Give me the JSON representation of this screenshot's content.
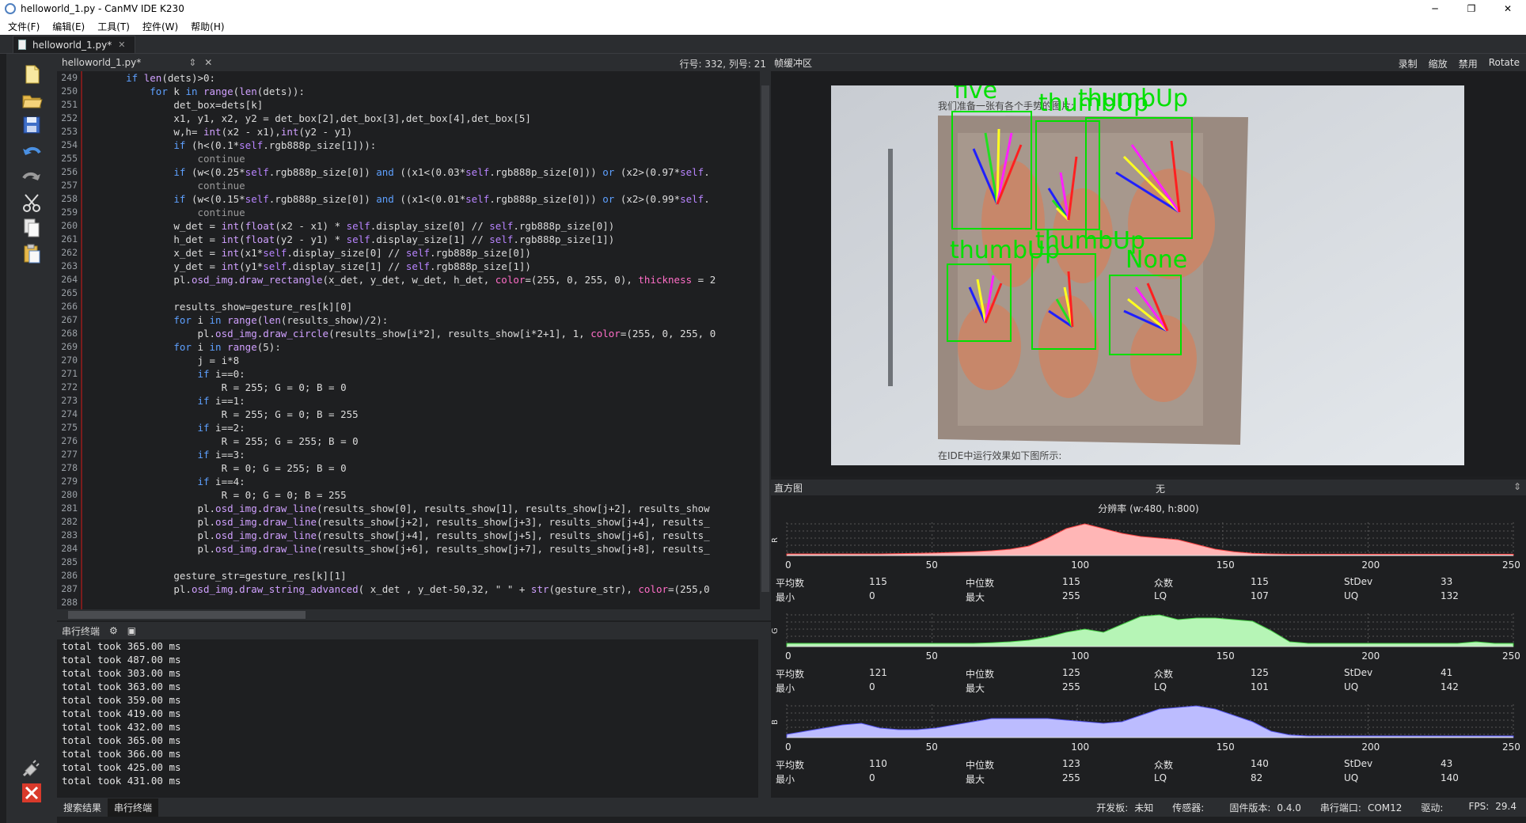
{
  "window": {
    "title": "helloworld_1.py - CanMV IDE K230",
    "controls": {
      "minimize": "─",
      "maximize": "❐",
      "close": "✕"
    }
  },
  "menu": [
    "文件(F)",
    "编辑(E)",
    "工具(T)",
    "控件(W)",
    "帮助(H)"
  ],
  "file_tabs": [
    {
      "label": "helloworld_1.py*"
    }
  ],
  "editor": {
    "tab_label": "helloworld_1.py*",
    "position": "行号: 332, 列号: 21",
    "line_numbers": [
      "249",
      "250",
      "251",
      "252",
      "253",
      "254",
      "255",
      "256",
      "257",
      "258",
      "259",
      "260",
      "261",
      "262",
      "263",
      "264",
      "265",
      "266",
      "267",
      "268",
      "269",
      "270",
      "271",
      "272",
      "273",
      "274",
      "275",
      "276",
      "277",
      "278",
      "279",
      "280",
      "281",
      "282",
      "283",
      "284",
      "285",
      "286",
      "287",
      "288"
    ],
    "lines": [
      [
        [
          "      ",
          "t"
        ],
        [
          "if ",
          "kw"
        ],
        [
          "len",
          "fn"
        ],
        [
          "(dets)>0:",
          "t"
        ]
      ],
      [
        [
          "          ",
          "t"
        ],
        [
          "for ",
          "kw"
        ],
        [
          "k ",
          "t"
        ],
        [
          "in ",
          "kw"
        ],
        [
          "range",
          "fn"
        ],
        [
          "(",
          "t"
        ],
        [
          "len",
          "fn"
        ],
        [
          "(dets)):",
          "t"
        ]
      ],
      [
        [
          "              det_box=dets[k]",
          "t"
        ]
      ],
      [
        [
          "              x1, y1, x2, y2 = det_box[2],det_box[3],det_box[4],det_box[5]",
          "t"
        ]
      ],
      [
        [
          "              w,h= ",
          "t"
        ],
        [
          "int",
          "fn"
        ],
        [
          "(x2 - x1),",
          "t"
        ],
        [
          "int",
          "fn"
        ],
        [
          "(y2 - y1)",
          "t"
        ]
      ],
      [
        [
          "              ",
          "t"
        ],
        [
          "if ",
          "kw"
        ],
        [
          "(h<(0.1*",
          "t"
        ],
        [
          "self",
          "dim"
        ],
        [
          ".rgb888p_size[1])):",
          "t"
        ]
      ],
      [
        [
          "                  continue",
          "grey"
        ]
      ],
      [
        [
          "              ",
          "t"
        ],
        [
          "if ",
          "kw"
        ],
        [
          "(w<(0.25*",
          "t"
        ],
        [
          "self",
          "dim"
        ],
        [
          ".rgb888p_size[0]) ",
          "t"
        ],
        [
          "and ",
          "kw"
        ],
        [
          "((x1<(0.03*",
          "t"
        ],
        [
          "self",
          "dim"
        ],
        [
          ".rgb888p_size[0])) ",
          "t"
        ],
        [
          "or ",
          "kw"
        ],
        [
          "(x2>(0.97*",
          "t"
        ],
        [
          "self",
          "dim"
        ],
        [
          ".",
          "t"
        ]
      ],
      [
        [
          "                  continue",
          "grey"
        ]
      ],
      [
        [
          "              ",
          "t"
        ],
        [
          "if ",
          "kw"
        ],
        [
          "(w<(0.15*",
          "t"
        ],
        [
          "self",
          "dim"
        ],
        [
          ".rgb888p_size[0]) ",
          "t"
        ],
        [
          "and ",
          "kw"
        ],
        [
          "((x1<(0.01*",
          "t"
        ],
        [
          "self",
          "dim"
        ],
        [
          ".rgb888p_size[0])) ",
          "t"
        ],
        [
          "or ",
          "kw"
        ],
        [
          "(x2>(0.99*",
          "t"
        ],
        [
          "self",
          "dim"
        ],
        [
          ".",
          "t"
        ]
      ],
      [
        [
          "                  continue",
          "grey"
        ]
      ],
      [
        [
          "              w_det = ",
          "t"
        ],
        [
          "int",
          "fn"
        ],
        [
          "(",
          "t"
        ],
        [
          "float",
          "fn"
        ],
        [
          "(x2 - x1) * ",
          "t"
        ],
        [
          "self",
          "dim"
        ],
        [
          ".display_size[0] // ",
          "t"
        ],
        [
          "self",
          "dim"
        ],
        [
          ".rgb888p_size[0])",
          "t"
        ]
      ],
      [
        [
          "              h_det = ",
          "t"
        ],
        [
          "int",
          "fn"
        ],
        [
          "(",
          "t"
        ],
        [
          "float",
          "fn"
        ],
        [
          "(y2 - y1) * ",
          "t"
        ],
        [
          "self",
          "dim"
        ],
        [
          ".display_size[1] // ",
          "t"
        ],
        [
          "self",
          "dim"
        ],
        [
          ".rgb888p_size[1])",
          "t"
        ]
      ],
      [
        [
          "              x_det = ",
          "t"
        ],
        [
          "int",
          "fn"
        ],
        [
          "(x1*",
          "t"
        ],
        [
          "self",
          "dim"
        ],
        [
          ".display_size[0] // ",
          "t"
        ],
        [
          "self",
          "dim"
        ],
        [
          ".rgb888p_size[0])",
          "t"
        ]
      ],
      [
        [
          "              y_det = ",
          "t"
        ],
        [
          "int",
          "fn"
        ],
        [
          "(y1*",
          "t"
        ],
        [
          "self",
          "dim"
        ],
        [
          ".display_size[1] // ",
          "t"
        ],
        [
          "self",
          "dim"
        ],
        [
          ".rgb888p_size[1])",
          "t"
        ]
      ],
      [
        [
          "              pl.",
          "t"
        ],
        [
          "osd_img",
          "fn"
        ],
        [
          ".",
          "t"
        ],
        [
          "draw_rectangle",
          "fn"
        ],
        [
          "(x_det, y_det, w_det, h_det, ",
          "t"
        ],
        [
          "color",
          "kwarg"
        ],
        [
          "=(255, 0, 255, 0), ",
          "t"
        ],
        [
          "thickness",
          "kwarg"
        ],
        [
          " = 2",
          "t"
        ]
      ],
      [
        [
          "",
          "t"
        ]
      ],
      [
        [
          "              results_show=gesture_res[k][0]",
          "t"
        ]
      ],
      [
        [
          "              ",
          "t"
        ],
        [
          "for ",
          "kw"
        ],
        [
          "i ",
          "t"
        ],
        [
          "in ",
          "kw"
        ],
        [
          "range",
          "fn"
        ],
        [
          "(",
          "t"
        ],
        [
          "len",
          "fn"
        ],
        [
          "(results_show)/2):",
          "t"
        ]
      ],
      [
        [
          "                  pl.",
          "t"
        ],
        [
          "osd_img",
          "fn"
        ],
        [
          ".",
          "t"
        ],
        [
          "draw_circle",
          "fn"
        ],
        [
          "(results_show[i*2], results_show[i*2+1], 1, ",
          "t"
        ],
        [
          "color",
          "kwarg"
        ],
        [
          "=(255, 0, 255, 0",
          "t"
        ]
      ],
      [
        [
          "              ",
          "t"
        ],
        [
          "for ",
          "kw"
        ],
        [
          "i ",
          "t"
        ],
        [
          "in ",
          "kw"
        ],
        [
          "range",
          "fn"
        ],
        [
          "(5):",
          "t"
        ]
      ],
      [
        [
          "                  j = i*8",
          "t"
        ]
      ],
      [
        [
          "                  ",
          "t"
        ],
        [
          "if ",
          "kw"
        ],
        [
          "i==0:",
          "t"
        ]
      ],
      [
        [
          "                      R = 255; G = 0; B = 0",
          "t"
        ]
      ],
      [
        [
          "                  ",
          "t"
        ],
        [
          "if ",
          "kw"
        ],
        [
          "i==1:",
          "t"
        ]
      ],
      [
        [
          "                      R = 255; G = 0; B = 255",
          "t"
        ]
      ],
      [
        [
          "                  ",
          "t"
        ],
        [
          "if ",
          "kw"
        ],
        [
          "i==2:",
          "t"
        ]
      ],
      [
        [
          "                      R = 255; G = 255; B = 0",
          "t"
        ]
      ],
      [
        [
          "                  ",
          "t"
        ],
        [
          "if ",
          "kw"
        ],
        [
          "i==3:",
          "t"
        ]
      ],
      [
        [
          "                      R = 0; G = 255; B = 0",
          "t"
        ]
      ],
      [
        [
          "                  ",
          "t"
        ],
        [
          "if ",
          "kw"
        ],
        [
          "i==4:",
          "t"
        ]
      ],
      [
        [
          "                      R = 0; G = 0; B = 255",
          "t"
        ]
      ],
      [
        [
          "                  pl.",
          "t"
        ],
        [
          "osd_img",
          "fn"
        ],
        [
          ".",
          "t"
        ],
        [
          "draw_line",
          "fn"
        ],
        [
          "(results_show[0], results_show[1], results_show[j+2], results_show",
          "t"
        ]
      ],
      [
        [
          "                  pl.",
          "t"
        ],
        [
          "osd_img",
          "fn"
        ],
        [
          ".",
          "t"
        ],
        [
          "draw_line",
          "fn"
        ],
        [
          "(results_show[j+2], results_show[j+3], results_show[j+4], results_",
          "t"
        ]
      ],
      [
        [
          "                  pl.",
          "t"
        ],
        [
          "osd_img",
          "fn"
        ],
        [
          ".",
          "t"
        ],
        [
          "draw_line",
          "fn"
        ],
        [
          "(results_show[j+4], results_show[j+5], results_show[j+6], results_",
          "t"
        ]
      ],
      [
        [
          "                  pl.",
          "t"
        ],
        [
          "osd_img",
          "fn"
        ],
        [
          ".",
          "t"
        ],
        [
          "draw_line",
          "fn"
        ],
        [
          "(results_show[j+6], results_show[j+7], results_show[j+8], results_",
          "t"
        ]
      ],
      [
        [
          "",
          "t"
        ]
      ],
      [
        [
          "              gesture_str=gesture_res[k][1]",
          "t"
        ]
      ],
      [
        [
          "              pl.",
          "t"
        ],
        [
          "osd_img",
          "fn"
        ],
        [
          ".",
          "t"
        ],
        [
          "draw_string_advanced",
          "fn"
        ],
        [
          "( x_det , y_det-50,32, \" \" + ",
          "t"
        ],
        [
          "str",
          "fn"
        ],
        [
          "(gesture_str), ",
          "t"
        ],
        [
          "color",
          "kwarg"
        ],
        [
          "=(255,0",
          "t"
        ]
      ],
      [
        [
          "",
          "t"
        ]
      ]
    ]
  },
  "terminal": {
    "title": "串行终端",
    "lines": [
      "total took 365.00 ms",
      "total took 487.00 ms",
      "total took 303.00 ms",
      "total took 363.00 ms",
      "total took 359.00 ms",
      "total took 419.00 ms",
      "total took 432.00 ms",
      "total took 365.00 ms",
      "total took 366.00 ms",
      "total took 425.00 ms",
      "total took 431.00 ms"
    ]
  },
  "bottom_tabs": [
    "搜索结果",
    "串行终端"
  ],
  "status": {
    "board_label": "开发板:",
    "board_value": "未知",
    "sensor_label": "传感器:",
    "sensor_value": "",
    "firmware_label": "固件版本:",
    "firmware_value": "0.4.0",
    "port_label": "串行端口:",
    "port_value": "COM12",
    "driver_label": "驱动:",
    "driver_value": "",
    "fps_label": "FPS:",
    "fps_value": "29.4"
  },
  "framebuffer": {
    "title": "帧缓冲区",
    "actions": [
      "录制",
      "缩放",
      "禁用",
      "Rotate"
    ],
    "page_text_top": "我们准备一张有各个手势的图片:",
    "page_text_bottom": "在IDE中运行效果如下图所示:",
    "detections": [
      {
        "label": "five"
      },
      {
        "label": "thumbUp"
      },
      {
        "label": "thumbUp"
      },
      {
        "label": "thumbUp"
      },
      {
        "label": "thumbUp"
      },
      {
        "label": "None"
      }
    ]
  },
  "histogram": {
    "title": "直方图",
    "mode": "无",
    "resolution": "分辨率 (w:480, h:800)",
    "x_ticks": [
      "0",
      "50",
      "100",
      "150",
      "200",
      "250"
    ],
    "channels": [
      {
        "name": "R",
        "color": "#ffb6b6",
        "line": "#ff4444",
        "stats": {
          "mean_label": "平均数",
          "mean": "115",
          "median_label": "中位数",
          "median": "115",
          "mode_label": "众数",
          "mode": "115",
          "stdev_label": "StDev",
          "stdev": "33",
          "min_label": "最小",
          "min": "0",
          "max_label": "最大",
          "max": "255",
          "lq_label": "LQ",
          "lq": "107",
          "uq_label": "UQ",
          "uq": "132"
        }
      },
      {
        "name": "G",
        "color": "#b6f5b6",
        "line": "#44cc44",
        "stats": {
          "mean_label": "平均数",
          "mean": "121",
          "median_label": "中位数",
          "median": "125",
          "mode_label": "众数",
          "mode": "125",
          "stdev_label": "StDev",
          "stdev": "41",
          "min_label": "最小",
          "min": "0",
          "max_label": "最大",
          "max": "255",
          "lq_label": "LQ",
          "lq": "101",
          "uq_label": "UQ",
          "uq": "142"
        }
      },
      {
        "name": "B",
        "color": "#bcbcff",
        "line": "#5555ee",
        "stats": {
          "mean_label": "平均数",
          "mean": "110",
          "median_label": "中位数",
          "median": "123",
          "mode_label": "众数",
          "mode": "140",
          "stdev_label": "StDev",
          "stdev": "43",
          "min_label": "最小",
          "min": "0",
          "max_label": "最大",
          "max": "255",
          "lq_label": "LQ",
          "lq": "82",
          "uq_label": "UQ",
          "uq": "140"
        }
      }
    ]
  }
}
